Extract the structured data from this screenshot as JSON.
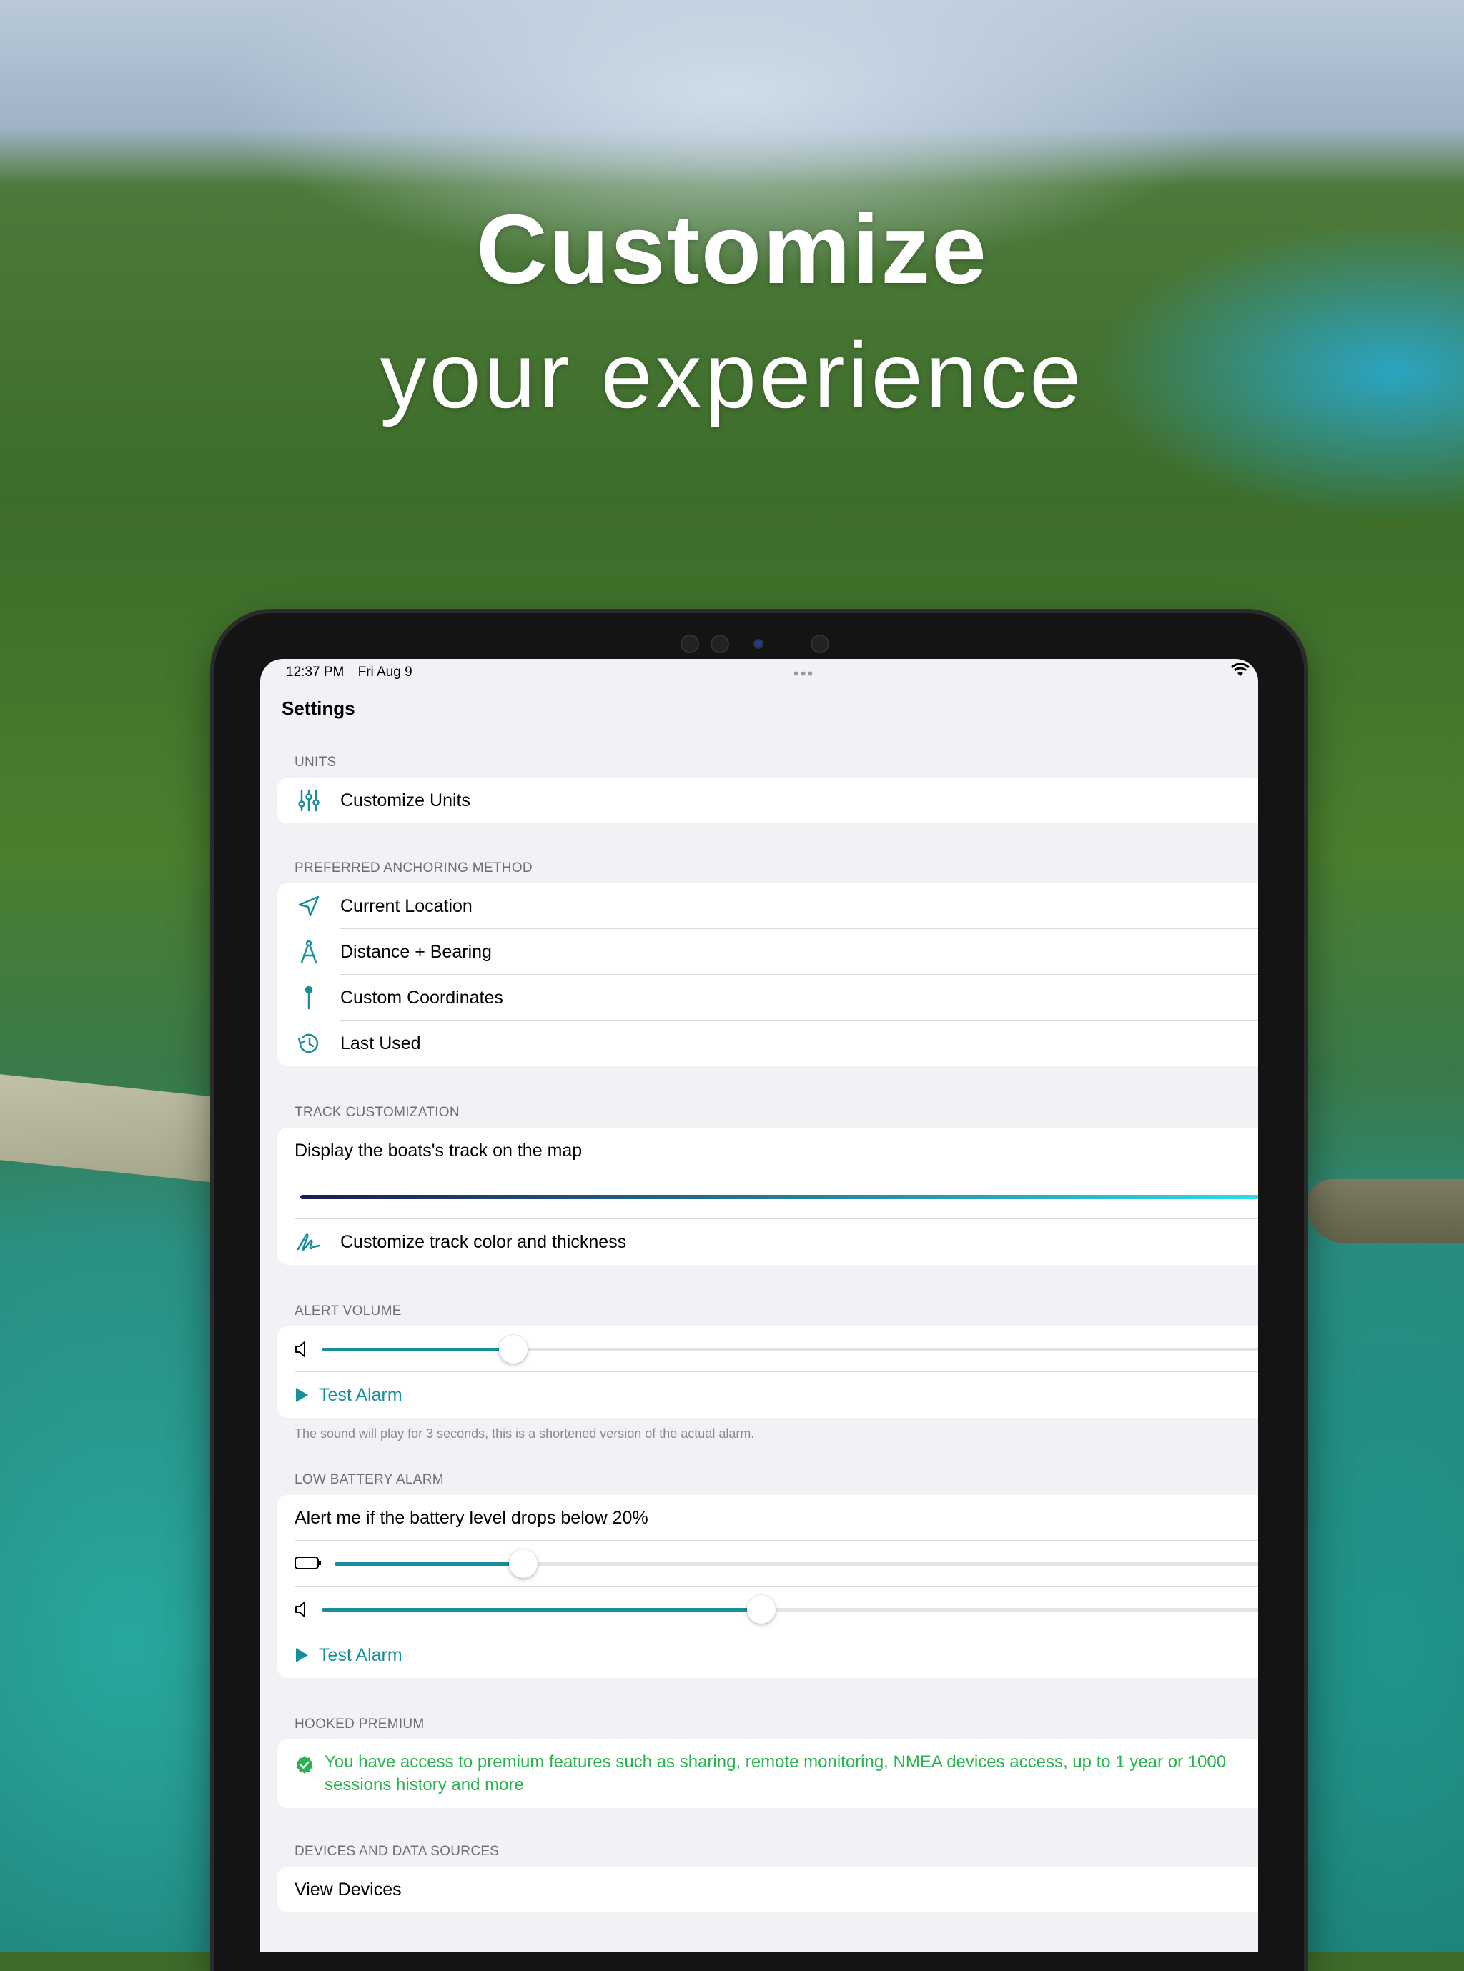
{
  "headline": {
    "title": "Customize",
    "subtitle": "your experience"
  },
  "status_bar": {
    "time": "12:37 PM",
    "date": "Fri Aug 9"
  },
  "page_title": "Settings",
  "sections": {
    "units": {
      "label": "UNITS",
      "customize_units": "Customize Units"
    },
    "anchoring": {
      "label": "PREFERRED ANCHORING METHOD",
      "items": [
        "Current Location",
        "Distance + Bearing",
        "Custom Coordinates",
        "Last Used"
      ]
    },
    "track": {
      "label": "TRACK CUSTOMIZATION",
      "display_track": "Display the boats's track on the map",
      "customize": "Customize track color and thickness",
      "gradient_start": "#1c1b4e",
      "gradient_end": "#2ee0e6"
    },
    "alert_volume": {
      "label": "ALERT VOLUME",
      "volume_level": 0.2,
      "test_alarm": "Test Alarm",
      "footnote": "The sound will play for 3 seconds, this is a shortened version of the actual alarm."
    },
    "low_battery": {
      "label": "LOW BATTERY ALARM",
      "description": "Alert me if the battery level drops below 20%",
      "battery_level": 0.2,
      "volume_level": 0.46,
      "test_alarm": "Test Alarm"
    },
    "premium": {
      "label": "HOOKED PREMIUM",
      "text": "You have access to premium features such as sharing, remote monitoring, NMEA devices access, up to 1 year or 1000 sessions history and more"
    },
    "devices": {
      "label": "DEVICES AND DATA SOURCES",
      "view_devices": "View Devices"
    }
  },
  "colors": {
    "accent": "#168f9b",
    "premium": "#2bb34f"
  }
}
